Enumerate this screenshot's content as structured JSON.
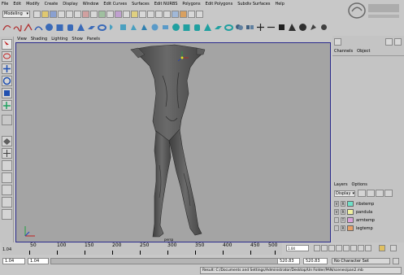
{
  "menu": [
    "File",
    "Edit",
    "Modify",
    "Create",
    "Display",
    "Window",
    "Edit Curves",
    "Surfaces",
    "Edit NURBS",
    "Polygons",
    "Edit Polygons",
    "Subdiv Surfaces",
    "Help"
  ],
  "status_line": {
    "mode": "Modeling"
  },
  "panel_menu": [
    "View",
    "Shading",
    "Lighting",
    "Show",
    "Panels"
  ],
  "viewport": {
    "camera_label": "persp"
  },
  "channel_box": {
    "channels_label": "Channels",
    "object_label": "Object"
  },
  "layer_editor": {
    "layers_label": "Layers",
    "options_label": "Options",
    "display_select": "Display",
    "layers": [
      {
        "visible": "V",
        "ref": "R",
        "name": "ribstemp",
        "color": "#6fe0c8"
      },
      {
        "visible": "V",
        "ref": "R",
        "name": "pandula",
        "color": "#f0f0a0"
      },
      {
        "visible": "",
        "ref": "T",
        "name": "armtemp",
        "color": "#d8a0d8"
      },
      {
        "visible": "",
        "ref": "R",
        "name": "legtemp",
        "color": "#e8a068"
      }
    ]
  },
  "timeline": {
    "ticks": [
      "50",
      "100",
      "150",
      "200",
      "250",
      "300",
      "350",
      "400",
      "450",
      "500"
    ],
    "start_label": "1.04",
    "current_frame": "1.04"
  },
  "range_slider": {
    "start": "1.04",
    "playback_start": "1.04",
    "playback_end": "520.83",
    "end": "520.83",
    "character_set": "No Character Set"
  },
  "help_line": {
    "result": "Result: C:/Documents and Settings/Administrator/Desktop/Un Folder/PAN/scenes/pan2.mb"
  },
  "colors": {
    "viewport_bg": "#a4a4a4",
    "ui_bg": "#c8c8c8",
    "viewport_border": "#2a2a8c",
    "character": "#585858"
  }
}
